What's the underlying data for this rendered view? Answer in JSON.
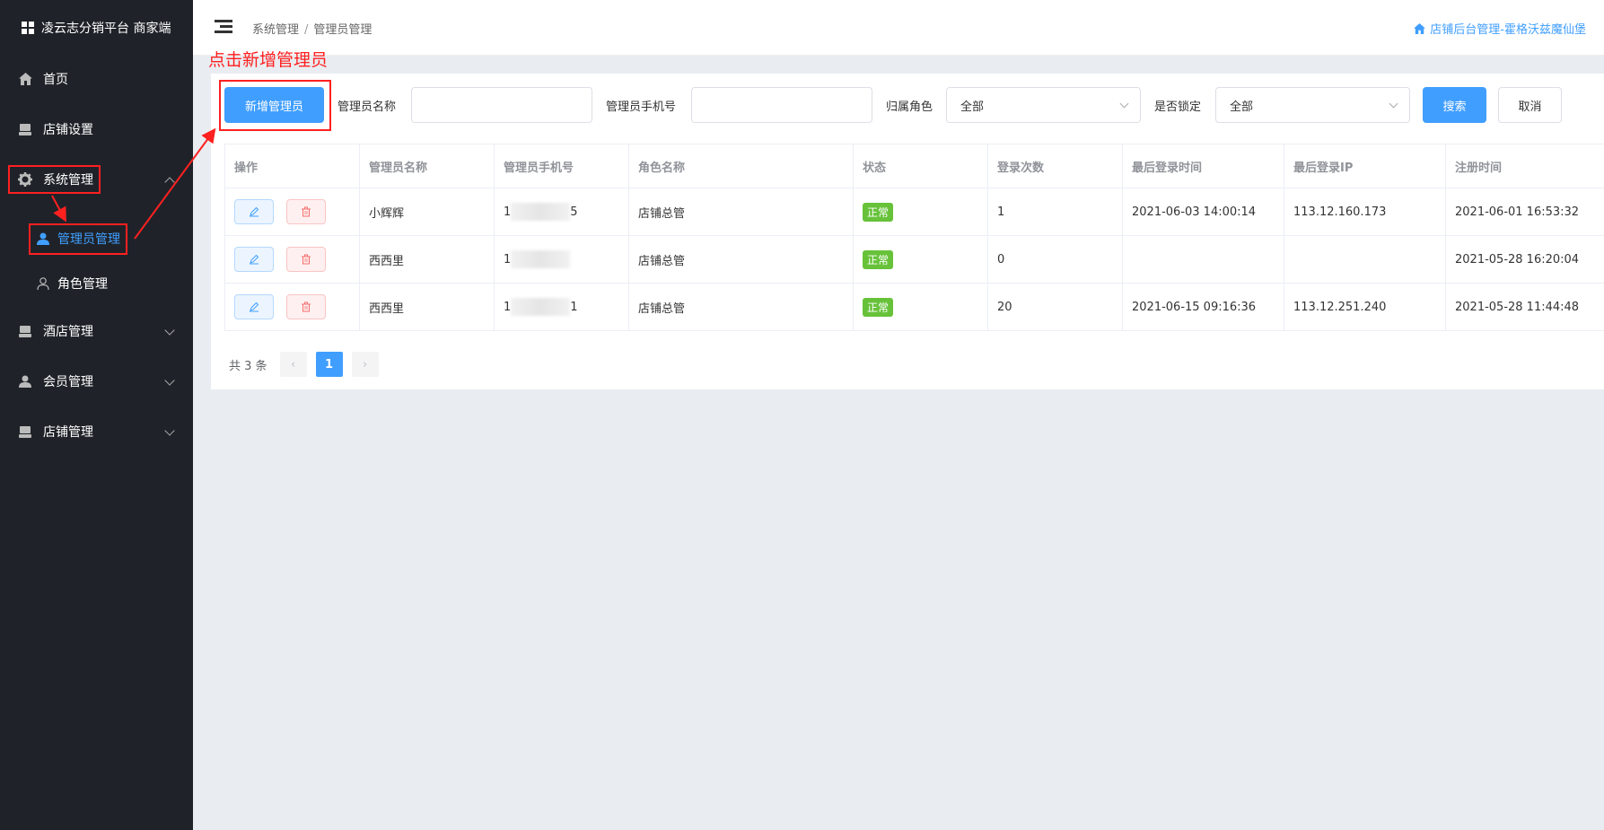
{
  "sidebar": {
    "brand": "凌云志分销平台 商家端",
    "items": [
      {
        "label": "首页",
        "icon": "home-icon"
      },
      {
        "label": "店铺设置",
        "icon": "shop-icon"
      },
      {
        "label": "系统管理",
        "icon": "gear-icon"
      },
      {
        "label": "酒店管理",
        "icon": "shop-icon"
      },
      {
        "label": "会员管理",
        "icon": "user-icon"
      },
      {
        "label": "店铺管理",
        "icon": "shop-icon"
      }
    ],
    "sub_items": [
      {
        "label": "管理员管理",
        "icon": "user-icon",
        "active": true
      },
      {
        "label": "角色管理",
        "icon": "user-outline-icon",
        "active": false
      }
    ]
  },
  "header": {
    "breadcrumb": [
      "系统管理",
      "管理员管理"
    ],
    "breadcrumb_sep": "/",
    "shop_link": "店铺后台管理-霍格沃兹魔仙堡"
  },
  "annotation": {
    "text": "点击新增管理员",
    "color": "#ff2020"
  },
  "filters": {
    "add_button": "新增管理员",
    "name_label": "管理员名称",
    "name_value": "",
    "phone_label": "管理员手机号",
    "phone_value": "",
    "role_label": "归属角色",
    "role_value": "全部",
    "locked_label": "是否锁定",
    "locked_value": "全部",
    "search_button": "搜索",
    "cancel_button": "取消"
  },
  "table": {
    "columns": [
      "操作",
      "管理员名称",
      "管理员手机号",
      "角色名称",
      "状态",
      "登录次数",
      "最后登录时间",
      "最后登录IP",
      "注册时间"
    ],
    "rows": [
      {
        "name": "小辉辉",
        "phone_start": "1",
        "phone_end": "5",
        "role": "店铺总管",
        "status": "正常",
        "logins": "1",
        "last_login": "2021-06-03 14:00:14",
        "last_ip": "113.12.160.173",
        "registered": "2021-06-01 16:53:32"
      },
      {
        "name": "西西里",
        "phone_start": "1",
        "phone_end": "",
        "role": "店铺总管",
        "status": "正常",
        "logins": "0",
        "last_login": "",
        "last_ip": "",
        "registered": "2021-05-28 16:20:04"
      },
      {
        "name": "西西里",
        "phone_start": "1",
        "phone_end": "1",
        "role": "店铺总管",
        "status": "正常",
        "logins": "20",
        "last_login": "2021-06-15 09:16:36",
        "last_ip": "113.12.251.240",
        "registered": "2021-05-28 11:44:48"
      }
    ]
  },
  "pagination": {
    "total_text": "共 3 条",
    "current_page": "1",
    "prev": "‹",
    "next": "›"
  },
  "colors": {
    "primary": "#409eff",
    "sidebar_bg": "#1f2329",
    "success": "#67c23a",
    "danger": "#f56c6c"
  }
}
